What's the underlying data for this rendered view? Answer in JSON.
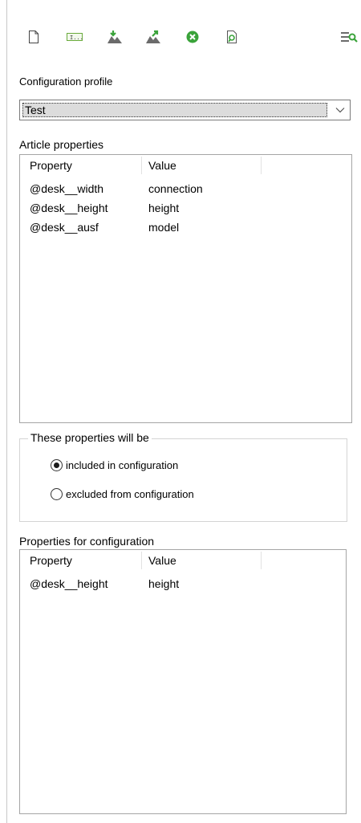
{
  "toolbar": {
    "icons": [
      "new-document-icon",
      "rename-field-icon",
      "import-icon",
      "export-icon",
      "delete-icon",
      "preview-icon",
      "settings-icon"
    ]
  },
  "profile": {
    "label": "Configuration profile",
    "selected": "Test"
  },
  "article_properties": {
    "label": "Article properties",
    "columns": [
      "Property",
      "Value"
    ],
    "rows": [
      {
        "property": "@desk__width",
        "value": "connection"
      },
      {
        "property": "@desk__height",
        "value": "height"
      },
      {
        "property": "@desk__ausf",
        "value": "model"
      }
    ]
  },
  "mode": {
    "title": "These properties will be",
    "options": [
      "included in configuration",
      "excluded from configuration"
    ],
    "selected_index": 0
  },
  "config_properties": {
    "label": "Properties for configuration",
    "columns": [
      "Property",
      "Value"
    ],
    "rows": [
      {
        "property": "@desk__height",
        "value": "height"
      }
    ]
  },
  "colors": {
    "icon_green": "#3aa33a",
    "icon_gray": "#6b6b6b"
  }
}
